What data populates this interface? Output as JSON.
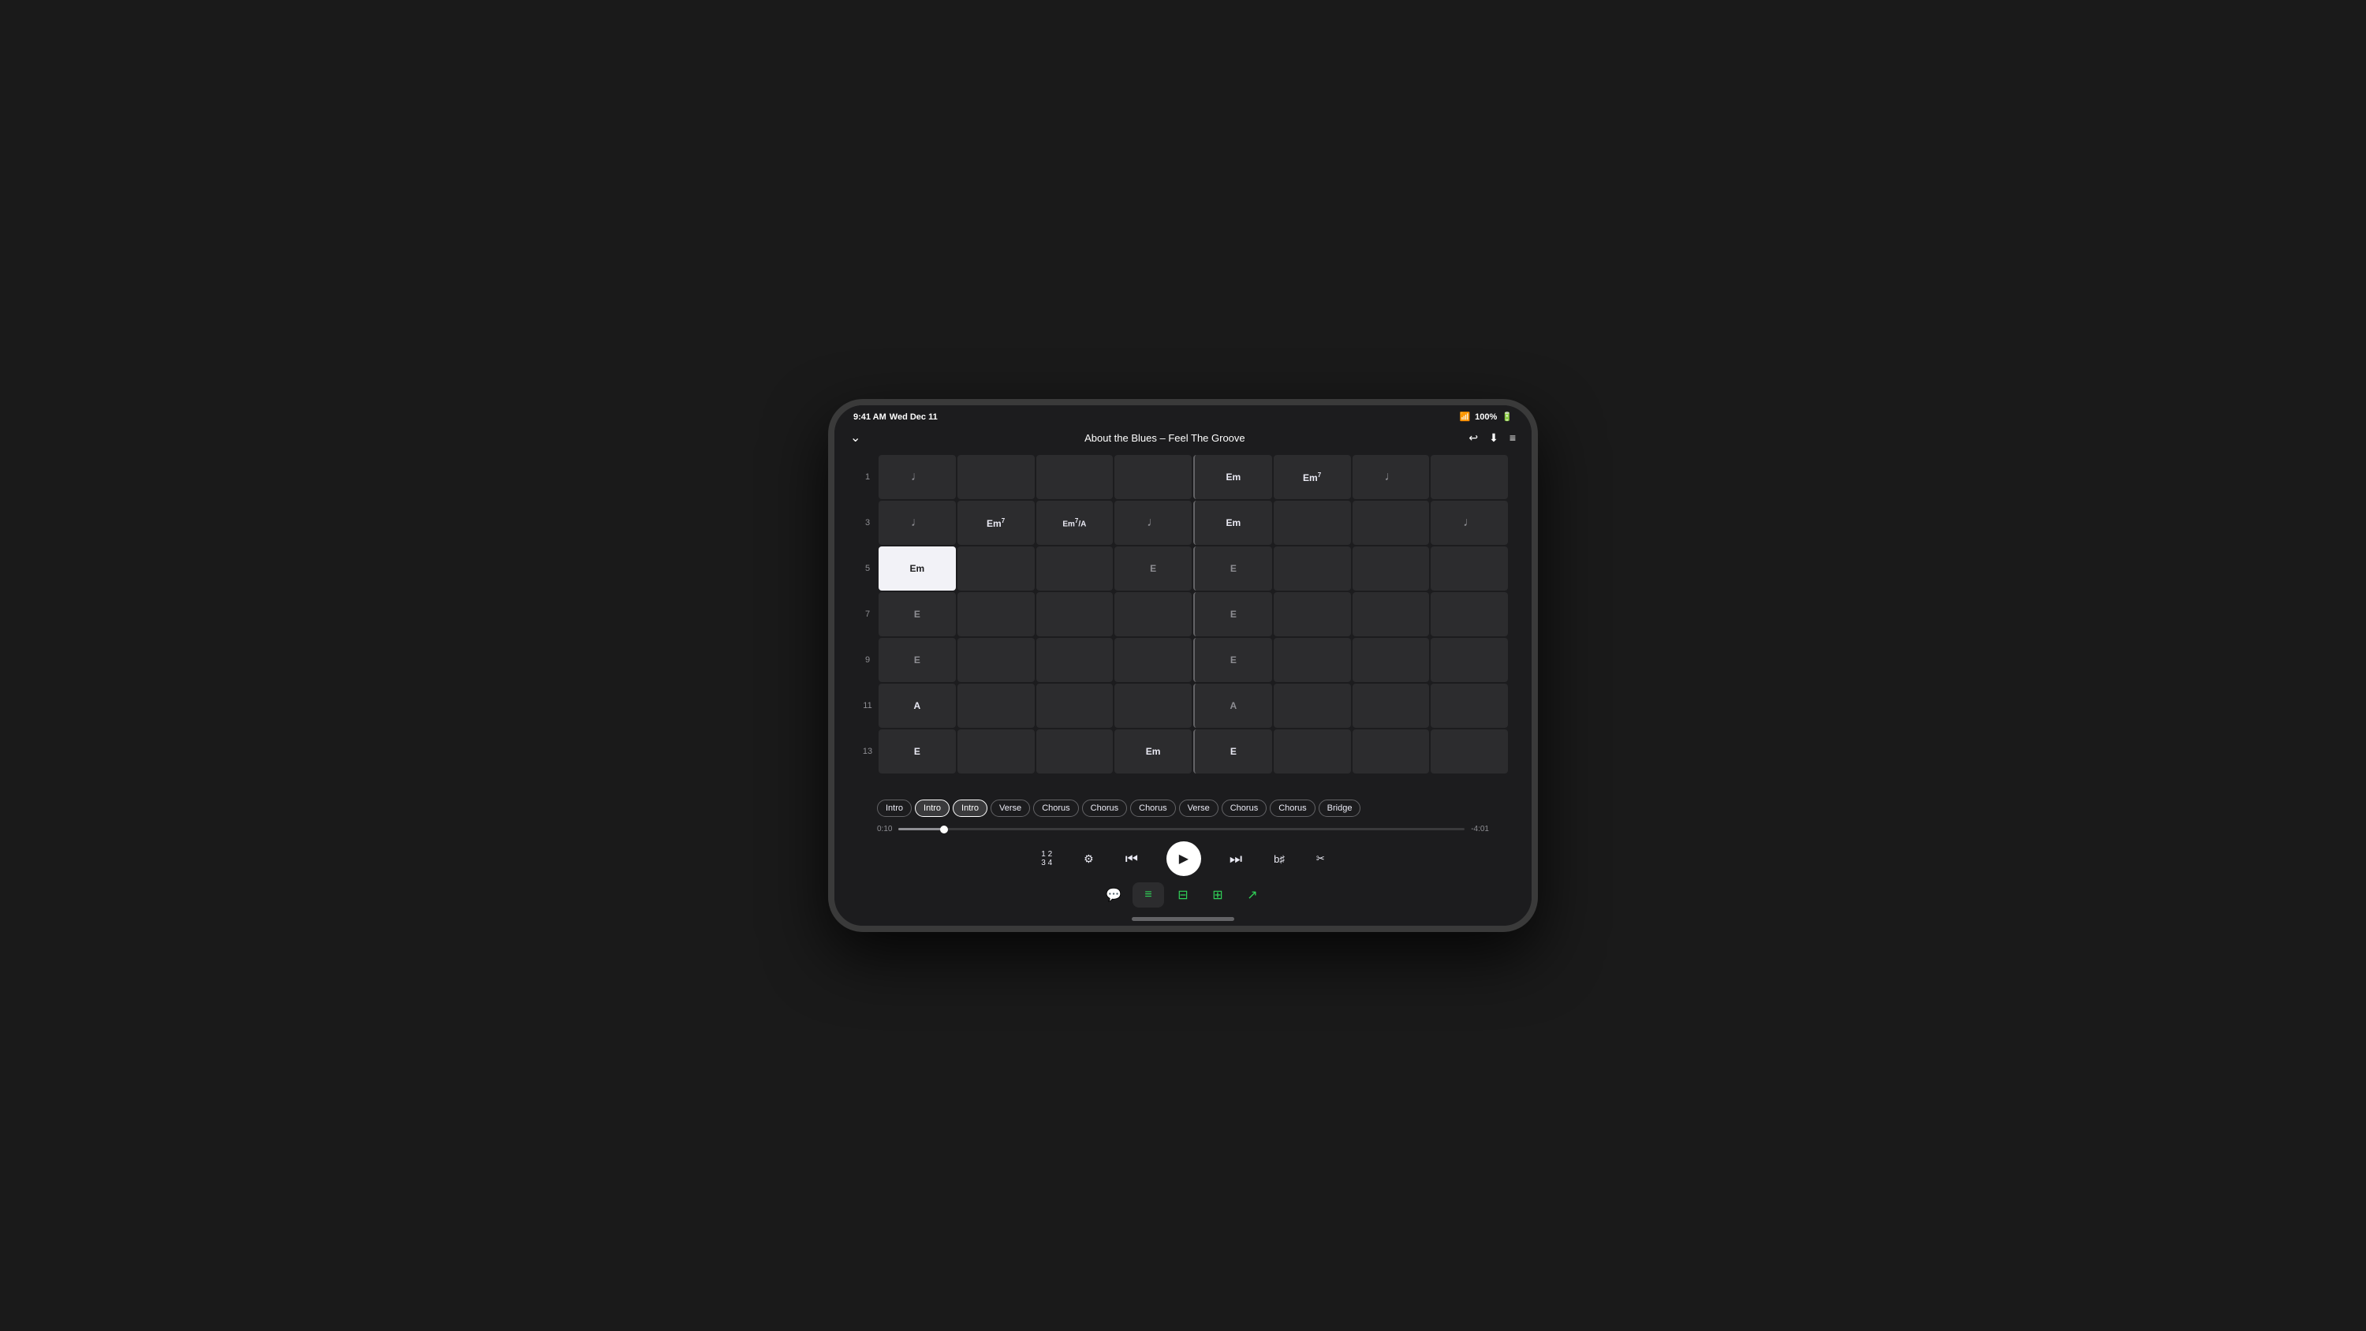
{
  "status": {
    "time": "9:41 AM",
    "date": "Wed Dec 11",
    "wifi": "100%",
    "battery": "100%"
  },
  "header": {
    "title": "About the Blues – Feel The Groove",
    "back_icon": "chevron-down",
    "undo_icon": "undo",
    "download_icon": "download",
    "menu_icon": "menu"
  },
  "grid": {
    "rows": [
      {
        "number": "1",
        "cells": [
          {
            "type": "rest",
            "text": "𝄽"
          },
          {
            "type": "empty",
            "text": ""
          },
          {
            "type": "empty",
            "text": ""
          },
          {
            "type": "empty",
            "text": ""
          },
          {
            "type": "chord",
            "text": "Em",
            "sup": ""
          },
          {
            "type": "chord",
            "text": "Em",
            "sup": "7"
          },
          {
            "type": "rest",
            "text": "𝄽"
          },
          {
            "type": "empty",
            "text": ""
          }
        ]
      },
      {
        "number": "3",
        "cells": [
          {
            "type": "rest",
            "text": "𝄽"
          },
          {
            "type": "chord",
            "text": "Em",
            "sup": "7"
          },
          {
            "type": "chord",
            "text": "Em⁷/A",
            "sup": ""
          },
          {
            "type": "rest",
            "text": "𝄽"
          },
          {
            "type": "chord",
            "text": "Em",
            "sup": ""
          },
          {
            "type": "empty",
            "text": ""
          },
          {
            "type": "empty",
            "text": ""
          },
          {
            "type": "rest",
            "text": "𝄽"
          }
        ]
      },
      {
        "number": "5",
        "cells": [
          {
            "type": "chord-active",
            "text": "Em",
            "sup": ""
          },
          {
            "type": "empty",
            "text": ""
          },
          {
            "type": "empty",
            "text": ""
          },
          {
            "type": "chord-dim",
            "text": "E",
            "sup": ""
          },
          {
            "type": "chord-dim",
            "text": "E",
            "sup": ""
          },
          {
            "type": "empty",
            "text": ""
          },
          {
            "type": "empty",
            "text": ""
          },
          {
            "type": "empty",
            "text": ""
          }
        ]
      },
      {
        "number": "7",
        "cells": [
          {
            "type": "chord-dim",
            "text": "E",
            "sup": ""
          },
          {
            "type": "empty",
            "text": ""
          },
          {
            "type": "empty",
            "text": ""
          },
          {
            "type": "empty",
            "text": ""
          },
          {
            "type": "chord-dim",
            "text": "E",
            "sup": ""
          },
          {
            "type": "empty",
            "text": ""
          },
          {
            "type": "empty",
            "text": ""
          },
          {
            "type": "empty",
            "text": ""
          }
        ]
      },
      {
        "number": "9",
        "cells": [
          {
            "type": "chord-dim",
            "text": "E",
            "sup": ""
          },
          {
            "type": "empty",
            "text": ""
          },
          {
            "type": "empty",
            "text": ""
          },
          {
            "type": "empty",
            "text": ""
          },
          {
            "type": "chord-dim",
            "text": "E",
            "sup": ""
          },
          {
            "type": "empty",
            "text": ""
          },
          {
            "type": "empty",
            "text": ""
          },
          {
            "type": "empty",
            "text": ""
          }
        ]
      },
      {
        "number": "11",
        "cells": [
          {
            "type": "chord",
            "text": "A",
            "sup": ""
          },
          {
            "type": "empty",
            "text": ""
          },
          {
            "type": "empty",
            "text": ""
          },
          {
            "type": "empty",
            "text": ""
          },
          {
            "type": "chord-dim",
            "text": "A",
            "sup": ""
          },
          {
            "type": "empty",
            "text": ""
          },
          {
            "type": "empty",
            "text": ""
          },
          {
            "type": "empty",
            "text": ""
          }
        ]
      },
      {
        "number": "13",
        "cells": [
          {
            "type": "chord",
            "text": "E",
            "sup": ""
          },
          {
            "type": "empty",
            "text": ""
          },
          {
            "type": "empty",
            "text": ""
          },
          {
            "type": "chord",
            "text": "Em",
            "sup": ""
          },
          {
            "type": "chord",
            "text": "E",
            "sup": ""
          },
          {
            "type": "empty",
            "text": ""
          },
          {
            "type": "empty",
            "text": ""
          },
          {
            "type": "empty",
            "text": ""
          }
        ]
      }
    ]
  },
  "sections": [
    {
      "label": "Intro",
      "active": false
    },
    {
      "label": "Intro",
      "active": true
    },
    {
      "label": "Intro",
      "active": true
    },
    {
      "label": "Verse",
      "active": false
    },
    {
      "label": "Chorus",
      "active": false
    },
    {
      "label": "Chorus",
      "active": false
    },
    {
      "label": "Chorus",
      "active": false
    },
    {
      "label": "Verse",
      "active": false
    },
    {
      "label": "Chorus",
      "active": false
    },
    {
      "label": "Chorus",
      "active": false
    },
    {
      "label": "Bridge",
      "active": false
    }
  ],
  "playback": {
    "current_time": "0:10",
    "total_time": "-4:01",
    "progress_pct": 8
  },
  "toolbar": {
    "items": [
      {
        "icon": "📝",
        "label": "lyrics",
        "active": false
      },
      {
        "icon": "≡",
        "label": "list",
        "active": true
      },
      {
        "icon": "⊞",
        "label": "grid2",
        "active": false
      },
      {
        "icon": "⊟",
        "label": "grid3",
        "active": false
      },
      {
        "icon": "↗",
        "label": "share",
        "active": false
      }
    ]
  }
}
